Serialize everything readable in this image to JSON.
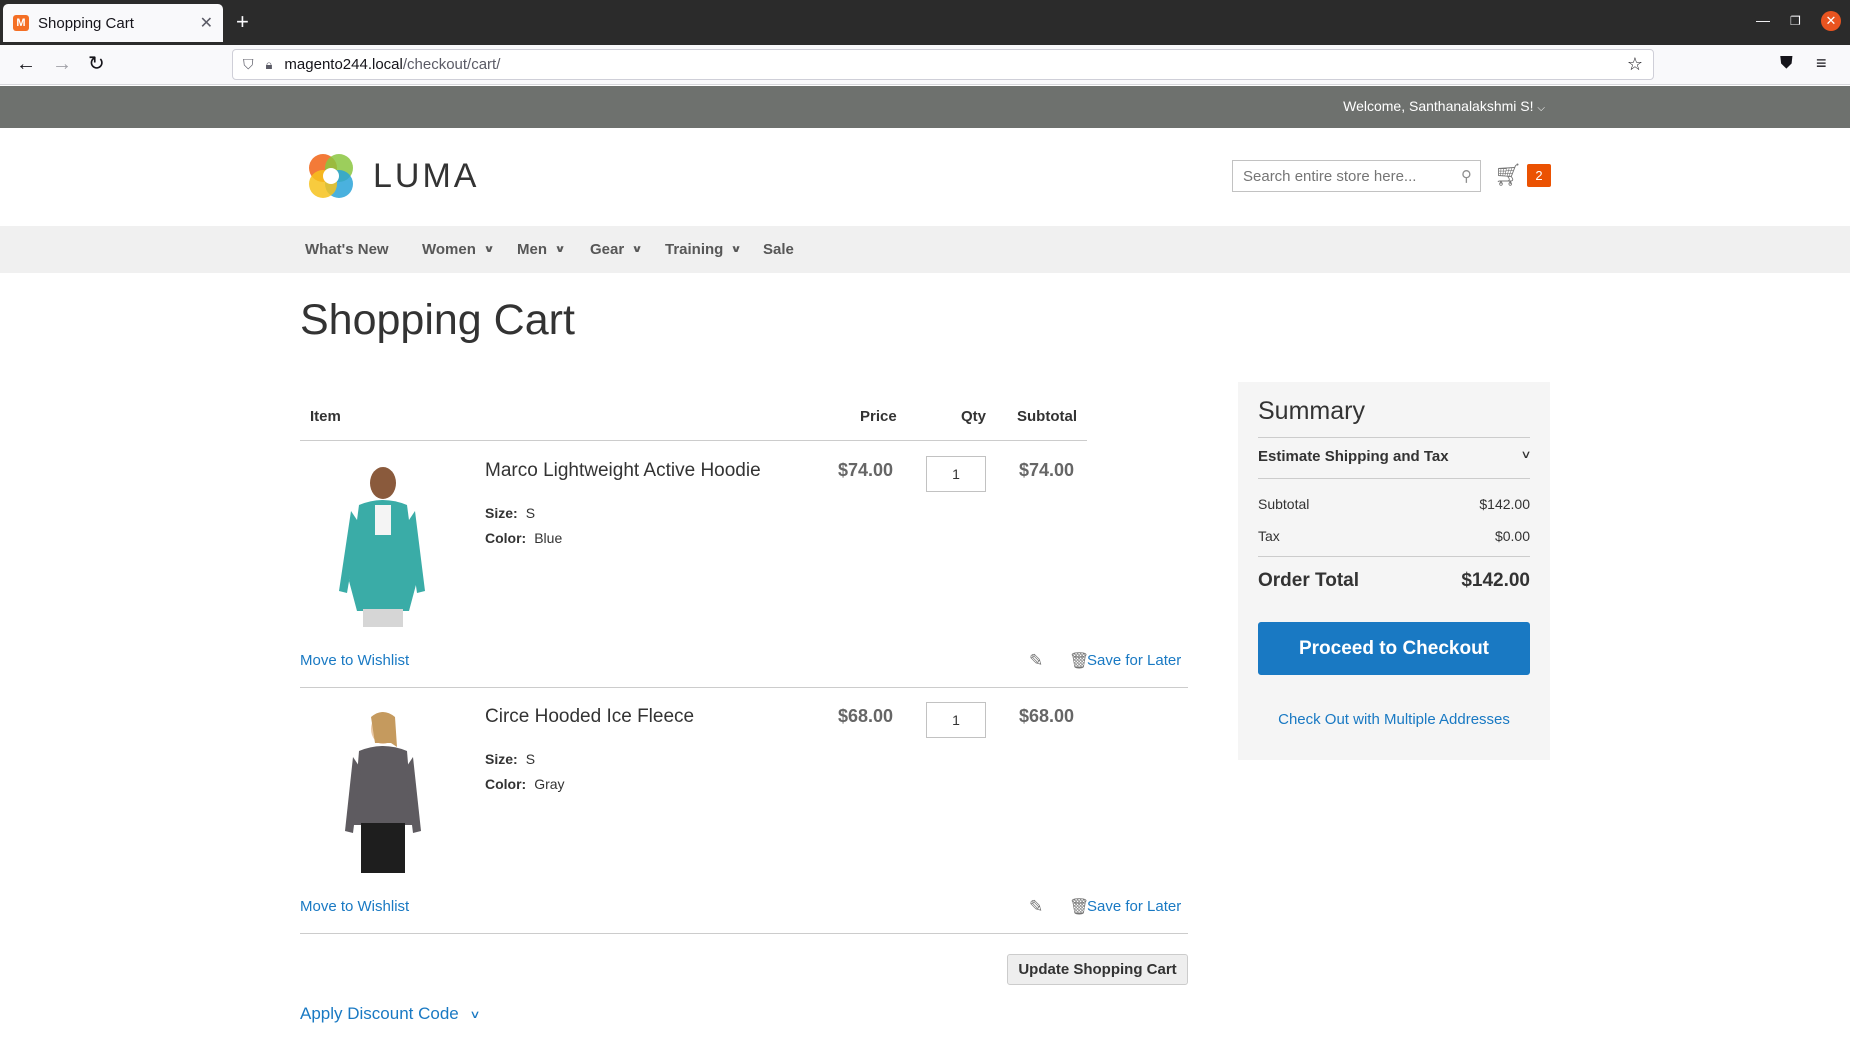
{
  "browser": {
    "tab_title": "Shopping Cart",
    "url_host": "magento244.local",
    "url_path": "/checkout/cart/"
  },
  "header": {
    "welcome": "Welcome, Santhanalakshmi S!",
    "logo_text": "LUMA",
    "search_placeholder": "Search entire store here...",
    "cart_count": "2"
  },
  "nav": {
    "items": [
      {
        "label": "What's New",
        "has_dropdown": false
      },
      {
        "label": "Women",
        "has_dropdown": true
      },
      {
        "label": "Men",
        "has_dropdown": true
      },
      {
        "label": "Gear",
        "has_dropdown": true
      },
      {
        "label": "Training",
        "has_dropdown": true
      },
      {
        "label": "Sale",
        "has_dropdown": false
      }
    ]
  },
  "cart": {
    "title": "Shopping Cart",
    "columns": {
      "item": "Item",
      "price": "Price",
      "qty": "Qty",
      "subtotal": "Subtotal"
    },
    "items": [
      {
        "name": "Marco Lightweight Active Hoodie",
        "size_label": "Size:",
        "size": "S",
        "color_label": "Color:",
        "color": "Blue",
        "price": "$74.00",
        "qty": "1",
        "subtotal": "$74.00",
        "move_to_wishlist": "Move to Wishlist",
        "save_for_later": "Save for Later",
        "image_color": "#3aaca7"
      },
      {
        "name": "Circe Hooded Ice Fleece",
        "size_label": "Size:",
        "size": "S",
        "color_label": "Color:",
        "color": "Gray",
        "price": "$68.00",
        "qty": "1",
        "subtotal": "$68.00",
        "move_to_wishlist": "Move to Wishlist",
        "save_for_later": "Save for Later",
        "image_color": "#5e5b60"
      }
    ],
    "update_button": "Update Shopping Cart",
    "discount_label": "Apply Discount Code"
  },
  "summary": {
    "title": "Summary",
    "estimate_label": "Estimate Shipping and Tax",
    "subtotal_label": "Subtotal",
    "subtotal": "$142.00",
    "tax_label": "Tax",
    "tax": "$0.00",
    "total_label": "Order Total",
    "total": "$142.00",
    "checkout_button": "Proceed to Checkout",
    "multi_address_link": "Check Out with Multiple Addresses"
  },
  "colors": {
    "link": "#1979c3",
    "primary_button": "#1979c3",
    "cart_counter": "#eb5202",
    "panel_header": "#6e716e"
  }
}
